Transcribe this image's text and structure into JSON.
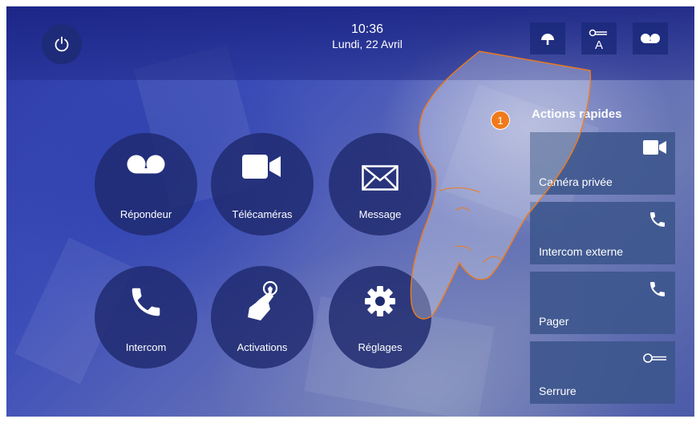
{
  "header": {
    "time": "10:36",
    "date": "Lundi, 22 Avril",
    "letter_a": "A"
  },
  "apps": [
    {
      "label": "Répondeur",
      "icon": "voicemail-icon"
    },
    {
      "label": "Télécaméras",
      "icon": "video-camera-icon"
    },
    {
      "label": "Message",
      "icon": "envelope-icon"
    },
    {
      "label": "Intercom",
      "icon": "phone-icon"
    },
    {
      "label": "Activations",
      "icon": "hand-touch-icon"
    },
    {
      "label": "Réglages",
      "icon": "gear-icon"
    }
  ],
  "quick_actions": {
    "title": "Actions rapides",
    "items": [
      {
        "label": "Caméra privée",
        "icon": "video-camera-icon"
      },
      {
        "label": "Intercom externe",
        "icon": "phone-icon"
      },
      {
        "label": "Pager",
        "icon": "phone-icon"
      },
      {
        "label": "Serrure",
        "icon": "key-icon"
      }
    ]
  },
  "callout": "1",
  "colors": {
    "accent": "#f07a1a",
    "panel": "#1e2b78"
  }
}
